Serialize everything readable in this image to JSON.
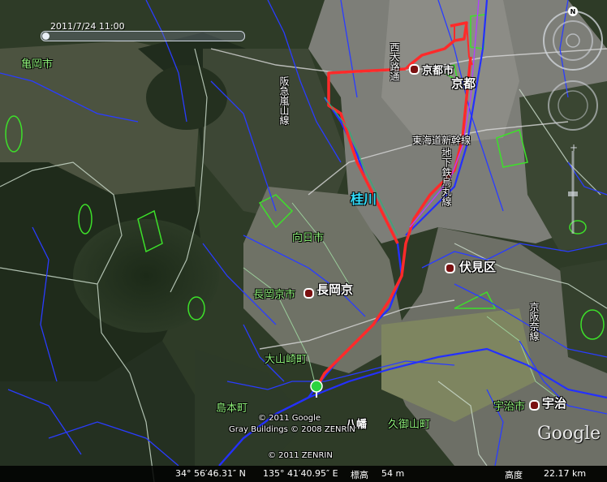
{
  "map": {
    "timestamp": "2011/7/24  11:00",
    "places": {
      "kameoka": "亀岡市",
      "kyoto_city": "京都市",
      "kyoto": "京都",
      "katsura_river": "桂川",
      "muko": "向日市",
      "fushimi": "伏見区",
      "nagaokakyo_city": "長岡京市",
      "nagaokakyo": "長岡京",
      "oyamazaki": "大山崎町",
      "shimamoto": "島本町",
      "kumiyama": "久御山町",
      "yawata": "八幡",
      "uji_city": "宇治市",
      "uji": "宇治"
    },
    "lines": {
      "hankyu_arashiyama": "阪急嵐山線",
      "tokaido_shinkansen": "東海道新幹線",
      "karasuma_subway": "地下鉄烏丸線",
      "keihan_nara": "京阪奈線",
      "nishioji": "西大路通"
    },
    "copyright": {
      "line1": "© 2011 Google",
      "line2": "Gray Buildings © 2008 ZENRIN",
      "line3": "© 2011 ZENRIN"
    },
    "status": {
      "lat": "34° 56′46.31″ N",
      "lon": "135° 41′40.95″ E",
      "elevation_label": "標高",
      "elevation": "54 m",
      "altitude_label": "高度",
      "altitude": "22.17 km"
    },
    "logo": "Google",
    "north": "N",
    "colors": {
      "route": "#ff2a2a",
      "water": "#2a3cff",
      "boundary": "#9fd6a0",
      "park": "#3de02a"
    }
  }
}
